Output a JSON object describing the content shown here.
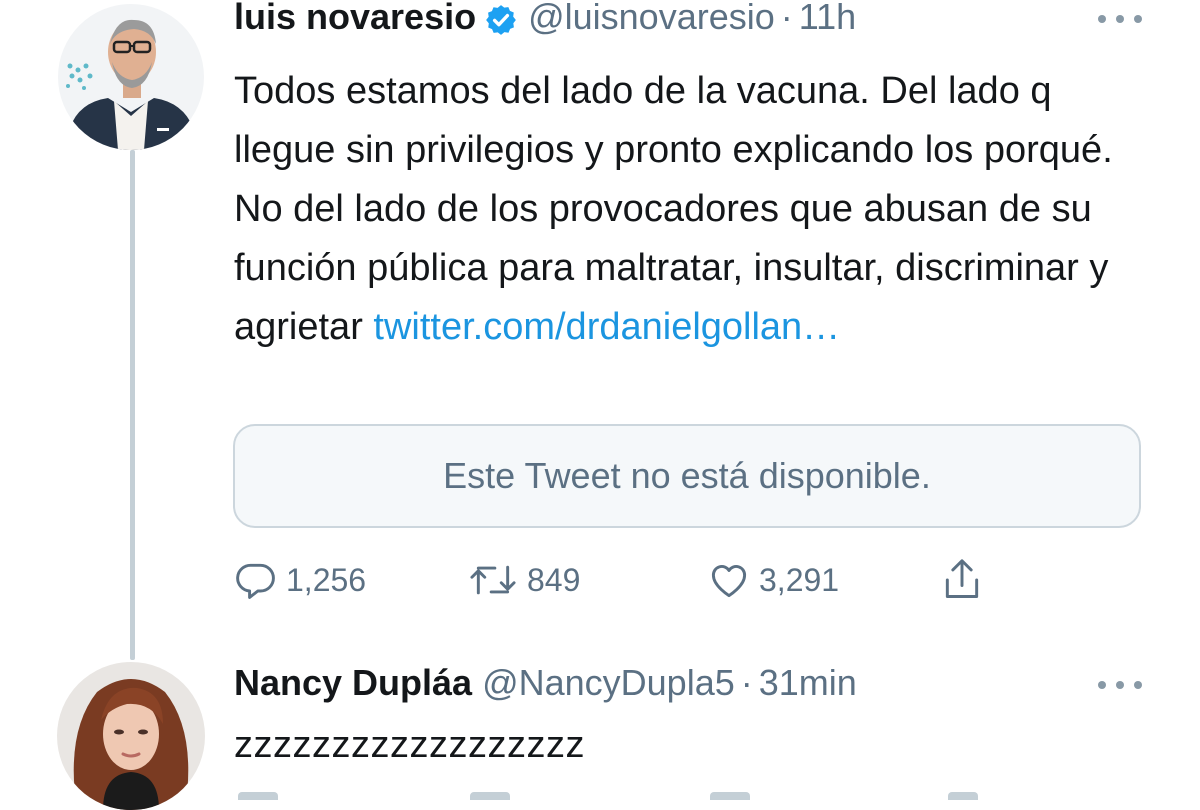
{
  "tweet": {
    "display_name": "luis novaresio",
    "verified": true,
    "handle": "@luisnovaresio",
    "separator": "·",
    "time": "11h",
    "text": "Todos estamos del lado  de la vacuna.  Del lado q llegue sin privilegios y pronto explicando los porqué. No del lado de los provocadores que abusan de su función pública para maltratar, insultar, discriminar y agrietar",
    "link": "twitter.com/drdanielgollan…",
    "quoted_unavailable": "Este Tweet no está disponible.",
    "counts": {
      "replies": "1,256",
      "retweets": "849",
      "likes": "3,291"
    },
    "icons": [
      "reply-icon",
      "retweet-icon",
      "like-icon",
      "share-icon",
      "more-icon",
      "verified-icon"
    ]
  },
  "reply": {
    "display_name": "Nancy Dupláa",
    "handle": "@NancyDupla5",
    "separator": "·",
    "time": "31min",
    "text": "zzzzzzzzzzzzzzzzzz"
  },
  "colors": {
    "text": "#14171a",
    "secondary": "#5b7083",
    "link": "#1b95e0",
    "verified": "#1da1f2",
    "border": "#ccd6dd",
    "thread_line": "#c4cfd6"
  }
}
